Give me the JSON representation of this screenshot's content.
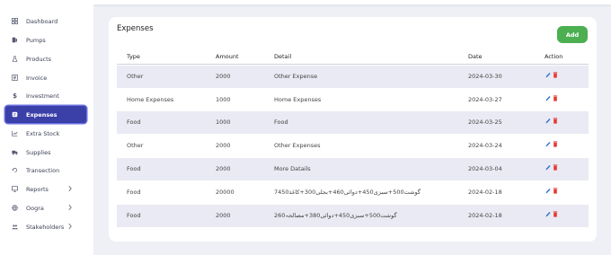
{
  "sidebar": {
    "items": [
      {
        "label": "Dashboard",
        "icon": "dashboard-icon"
      },
      {
        "label": "Pumps",
        "icon": "pump-icon"
      },
      {
        "label": "Products",
        "icon": "flask-icon"
      },
      {
        "label": "Invoice",
        "icon": "invoice-icon"
      },
      {
        "label": "Investment",
        "icon": "dollar-icon"
      },
      {
        "label": "Expenses",
        "icon": "expenses-icon",
        "active": true
      },
      {
        "label": "Extra Stock",
        "icon": "chart-icon"
      },
      {
        "label": "Supplies",
        "icon": "truck-icon"
      },
      {
        "label": "Transection",
        "icon": "exchange-icon"
      },
      {
        "label": "Reports",
        "icon": "monitor-icon",
        "chevron": true
      },
      {
        "label": "Oogra",
        "icon": "globe-icon",
        "chevron": true
      },
      {
        "label": "Stakeholders",
        "icon": "users-icon",
        "chevron": true
      }
    ]
  },
  "main": {
    "title": "Expenses",
    "add_label": "Add",
    "columns": [
      "Type",
      "Amount",
      "Detail",
      "Date",
      "Action"
    ],
    "rows": [
      {
        "type": "Other",
        "amount": "2000",
        "detail": "Other Expense",
        "date": "2024-03-30"
      },
      {
        "type": "Home Expenses",
        "amount": "1000",
        "detail": "Home Expenses",
        "date": "2024-03-27"
      },
      {
        "type": "Food",
        "amount": "1000",
        "detail": "Food",
        "date": "2024-03-25"
      },
      {
        "type": "Other",
        "amount": "2000",
        "detail": "Other Expenses",
        "date": "2024-03-24"
      },
      {
        "type": "Food",
        "amount": "2000",
        "detail": "More Datails",
        "date": "2024-03-04"
      },
      {
        "type": "Food",
        "amount": "20000",
        "detail": "گوشت500+سبزی450+دوائی460+بجلی300+کاغذ7450",
        "date": "2024-02-18"
      },
      {
        "type": "Food",
        "amount": "2000",
        "detail": "گوشت500+سبزی450+دوائی380+مصالحہ260",
        "date": "2024-02-18"
      }
    ]
  },
  "colors": {
    "accent": "#3b3fa8",
    "add_button": "#4caf50",
    "row_shade": "#e9eaf3",
    "edit_icon": "#2f6fd6",
    "delete_icon": "#e53935"
  }
}
